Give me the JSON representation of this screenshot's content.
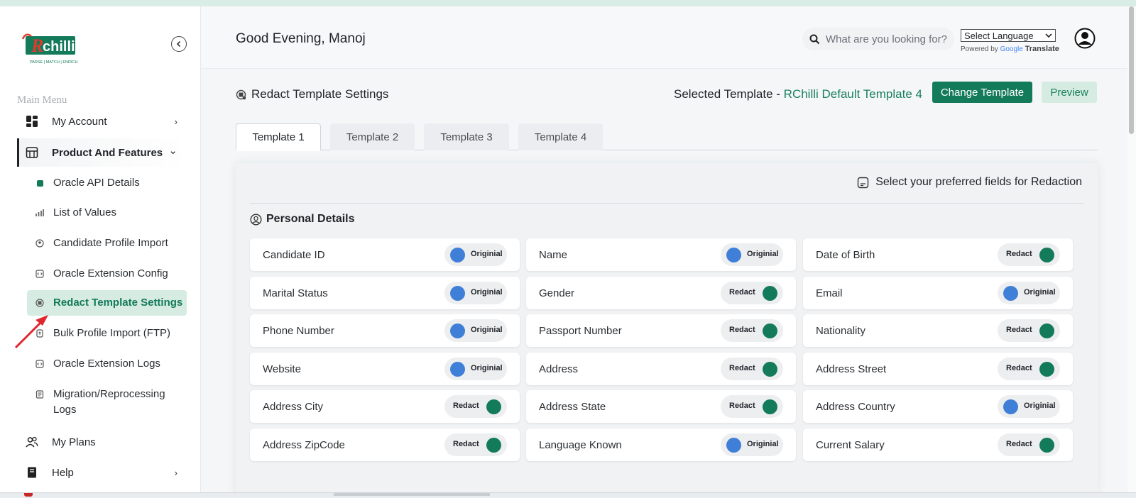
{
  "brand": {
    "name": "Rchilli",
    "tagline": "PARSE | MATCH | ENRICH",
    "accent": "#137a5a",
    "logo_red": "#e23a2b"
  },
  "sidebar": {
    "menu_heading": "Main Menu",
    "items": [
      {
        "label": "My Account",
        "icon": "dashboard-icon",
        "chevron": "›"
      },
      {
        "label": "Product And Features",
        "icon": "store-icon",
        "chevron": "⌄"
      },
      {
        "label": "My Plans",
        "icon": "users-icon"
      },
      {
        "label": "Help",
        "icon": "book-icon",
        "chevron": "›"
      }
    ],
    "sub_items": [
      {
        "label": "Oracle API Details",
        "icon": "api-icon"
      },
      {
        "label": "List of Values",
        "icon": "chart-icon"
      },
      {
        "label": "Candidate Profile Import",
        "icon": "profile-icon"
      },
      {
        "label": "Oracle Extension Config",
        "icon": "code-icon"
      },
      {
        "label": "Redact Template Settings",
        "icon": "redact-icon"
      },
      {
        "label": "Bulk Profile Import (FTP)",
        "icon": "upload-icon"
      },
      {
        "label": "Oracle Extension Logs",
        "icon": "code-icon"
      },
      {
        "label": "Migration/Reprocessing Logs",
        "icon": "log-icon"
      }
    ]
  },
  "header": {
    "greeting": "Good Evening, Manoj",
    "search_placeholder": "What are you looking for?",
    "language_select": "Select Language",
    "powered_by": "Powered by",
    "google": "Google",
    "translate": "Translate"
  },
  "page": {
    "title": "Redact Template Settings",
    "selected_label": "Selected Template - ",
    "selected_value": "RChilli Default Template 4",
    "change_button": "Change Template",
    "preview_button": "Preview",
    "tabs": [
      "Template 1",
      "Template 2",
      "Template 3",
      "Template 4"
    ],
    "active_tab": 0,
    "preference_text": "Select your preferred fields for Redaction",
    "section_title": "Personal Details"
  },
  "fields": [
    {
      "label": "Candidate ID",
      "state": "Originial"
    },
    {
      "label": "Name",
      "state": "Originial"
    },
    {
      "label": "Date of Birth",
      "state": "Redact"
    },
    {
      "label": "Marital Status",
      "state": "Originial"
    },
    {
      "label": "Gender",
      "state": "Redact"
    },
    {
      "label": "Email",
      "state": "Originial"
    },
    {
      "label": "Phone Number",
      "state": "Originial"
    },
    {
      "label": "Passport Number",
      "state": "Redact"
    },
    {
      "label": "Nationality",
      "state": "Redact"
    },
    {
      "label": "Website",
      "state": "Originial"
    },
    {
      "label": "Address",
      "state": "Redact"
    },
    {
      "label": "Address Street",
      "state": "Redact"
    },
    {
      "label": "Address City",
      "state": "Redact"
    },
    {
      "label": "Address State",
      "state": "Redact"
    },
    {
      "label": "Address Country",
      "state": "Originial"
    },
    {
      "label": "Address ZipCode",
      "state": "Redact"
    },
    {
      "label": "Language Known",
      "state": "Originial"
    },
    {
      "label": "Current Salary",
      "state": "Redact"
    }
  ],
  "colors": {
    "original_knob": "#3f7fd7",
    "redact_knob": "#137a5a",
    "active_sub_bg": "#d6ece3"
  }
}
